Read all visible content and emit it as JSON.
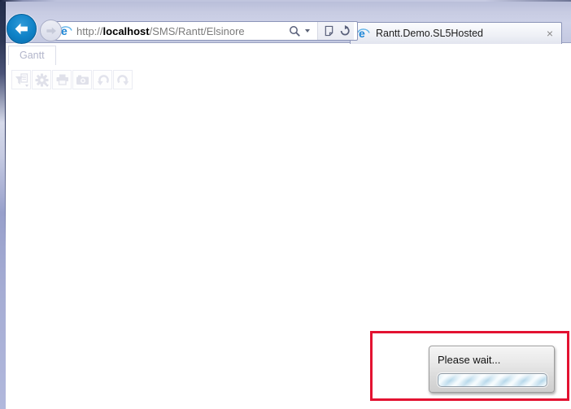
{
  "browser": {
    "address": {
      "prefix": "http://",
      "domain": "localhost",
      "path": "/SMS/Rantt/Elsinore",
      "icons": [
        "ie-favicon",
        "search-icon",
        "search-dropdown-caret",
        "compatibility-view-icon",
        "refresh-icon"
      ]
    },
    "tab": {
      "favicon": "ie-favicon",
      "title": "Rantt.Demo.SL5Hosted",
      "close_glyph": "×"
    }
  },
  "page": {
    "tab_label": "Gantt",
    "toolbar_icons": [
      "filter-report",
      "settings-gear",
      "print",
      "camera-snapshot",
      "undo",
      "redo"
    ]
  },
  "dialog": {
    "message": "Please wait...",
    "progress": "indeterminate-striped"
  },
  "annotation": {
    "type": "red-highlight-box"
  },
  "colors": {
    "chrome_background": "#c9cde4",
    "back_button_blue": "#0e81c6",
    "window_border_dark": "#2c3552",
    "window_border_light": "#aeb5da",
    "annotation_red": "#e31231",
    "progress_stripe_blue": "#b5d7ea",
    "dialog_top": "#f5f5f5",
    "dialog_bottom": "#cecece"
  }
}
